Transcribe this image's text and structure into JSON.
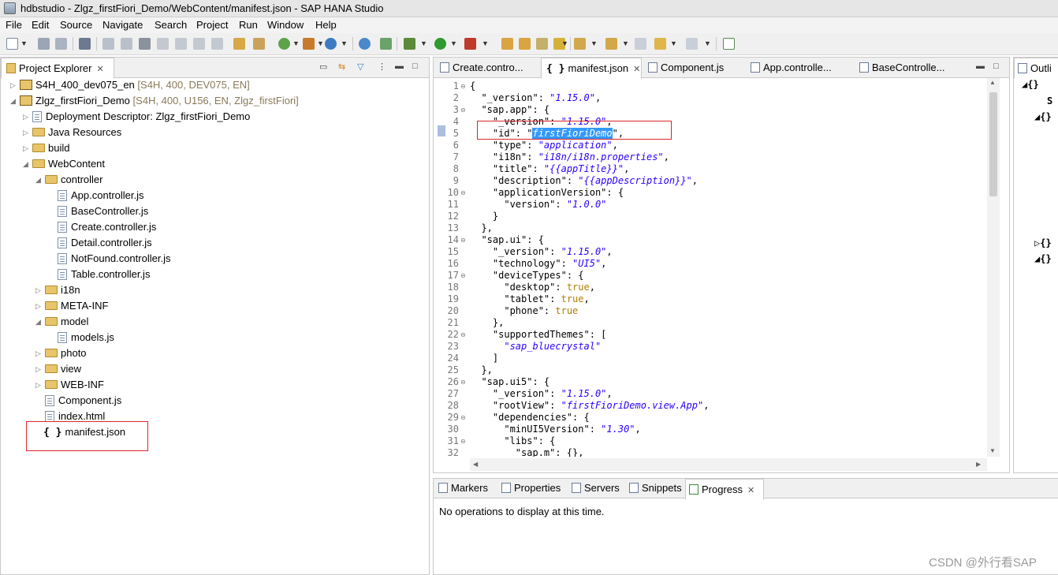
{
  "window": {
    "title": "hdbstudio - Zlgz_firstFiori_Demo/WebContent/manifest.json - SAP HANA Studio"
  },
  "menu": [
    "File",
    "Edit",
    "Source",
    "Navigate",
    "Search",
    "Project",
    "Run",
    "Window",
    "Help"
  ],
  "explorer": {
    "tab_label": "Project Explorer",
    "items": [
      {
        "label": "S4H_400_dev075_en",
        "suffix": "[S4H, 400, DEV075, EN]"
      },
      {
        "label": "Zlgz_firstFiori_Demo",
        "suffix": "[S4H, 400, U156, EN, Zlgz_firstFiori]"
      },
      {
        "label": "Deployment Descriptor: Zlgz_firstFiori_Demo"
      },
      {
        "label": "Java Resources"
      },
      {
        "label": "build"
      },
      {
        "label": "WebContent"
      },
      {
        "label": "controller"
      },
      {
        "label": "App.controller.js"
      },
      {
        "label": "BaseController.js"
      },
      {
        "label": "Create.controller.js"
      },
      {
        "label": "Detail.controller.js"
      },
      {
        "label": "NotFound.controller.js"
      },
      {
        "label": "Table.controller.js"
      },
      {
        "label": "i18n"
      },
      {
        "label": "META-INF"
      },
      {
        "label": "model"
      },
      {
        "label": "models.js"
      },
      {
        "label": "photo"
      },
      {
        "label": "view"
      },
      {
        "label": "WEB-INF"
      },
      {
        "label": "Component.js"
      },
      {
        "label": "index.html"
      },
      {
        "label": "manifest.json"
      }
    ]
  },
  "editor": {
    "tabs": [
      "Create.contro...",
      "manifest.json",
      "Component.js",
      "App.controlle...",
      "BaseControlle..."
    ],
    "lines": [
      [
        [
          "k",
          "{"
        ]
      ],
      [
        [
          "k",
          "  \"_version\": "
        ],
        [
          "s",
          "\"1.15.0\""
        ],
        [
          "k",
          ","
        ]
      ],
      [
        [
          "k",
          "  \"sap.app\": {"
        ]
      ],
      [
        [
          "k",
          "    \"_version\": "
        ],
        [
          "s",
          "\"1.15.0\""
        ],
        [
          "k",
          ","
        ]
      ],
      [
        [
          "k",
          "    \"id\": \""
        ],
        [
          "sel",
          "firstFioriDemo"
        ],
        [
          "k",
          "\","
        ]
      ],
      [
        [
          "k",
          "    \"type\": "
        ],
        [
          "s",
          "\"application\""
        ],
        [
          "k",
          ","
        ]
      ],
      [
        [
          "k",
          "    \"i18n\": "
        ],
        [
          "s",
          "\"i18n/i18n.properties\""
        ],
        [
          "k",
          ","
        ]
      ],
      [
        [
          "k",
          "    \"title\": "
        ],
        [
          "s",
          "\"{{appTitle}}\""
        ],
        [
          "k",
          ","
        ]
      ],
      [
        [
          "k",
          "    \"description\": "
        ],
        [
          "s",
          "\"{{appDescription}}\""
        ],
        [
          "k",
          ","
        ]
      ],
      [
        [
          "k",
          "    \"applicationVersion\": {"
        ]
      ],
      [
        [
          "k",
          "      \"version\": "
        ],
        [
          "s",
          "\"1.0.0\""
        ]
      ],
      [
        [
          "k",
          "    }"
        ]
      ],
      [
        [
          "k",
          "  },"
        ]
      ],
      [
        [
          "k",
          "  \"sap.ui\": {"
        ]
      ],
      [
        [
          "k",
          "    \"_version\": "
        ],
        [
          "s",
          "\"1.15.0\""
        ],
        [
          "k",
          ","
        ]
      ],
      [
        [
          "k",
          "    \"technology\": "
        ],
        [
          "s",
          "\"UI5\""
        ],
        [
          "k",
          ","
        ]
      ],
      [
        [
          "k",
          "    \"deviceTypes\": {"
        ]
      ],
      [
        [
          "k",
          "      \"desktop\": "
        ],
        [
          "t",
          "true"
        ],
        [
          "k",
          ","
        ]
      ],
      [
        [
          "k",
          "      \"tablet\": "
        ],
        [
          "t",
          "true"
        ],
        [
          "k",
          ","
        ]
      ],
      [
        [
          "k",
          "      \"phone\": "
        ],
        [
          "t",
          "true"
        ]
      ],
      [
        [
          "k",
          "    },"
        ]
      ],
      [
        [
          "k",
          "    \"supportedThemes\": ["
        ]
      ],
      [
        [
          "s",
          "      \"sap_bluecrystal\""
        ]
      ],
      [
        [
          "k",
          "    ]"
        ]
      ],
      [
        [
          "k",
          "  },"
        ]
      ],
      [
        [
          "k",
          "  \"sap.ui5\": {"
        ]
      ],
      [
        [
          "k",
          "    \"_version\": "
        ],
        [
          "s",
          "\"1.15.0\""
        ],
        [
          "k",
          ","
        ]
      ],
      [
        [
          "k",
          "    \"rootView\": "
        ],
        [
          "s",
          "\"firstFioriDemo.view.App\""
        ],
        [
          "k",
          ","
        ]
      ],
      [
        [
          "k",
          "    \"dependencies\": {"
        ]
      ],
      [
        [
          "k",
          "      \"minUI5Version\": "
        ],
        [
          "s",
          "\"1.30\""
        ],
        [
          "k",
          ","
        ]
      ],
      [
        [
          "k",
          "      \"libs\": {"
        ]
      ],
      [
        [
          "k",
          "        \"sap.m\": {},"
        ]
      ]
    ]
  },
  "bottom": {
    "tabs": [
      "Markers",
      "Properties",
      "Servers",
      "Snippets",
      "Progress"
    ],
    "message": "No operations to display at this time."
  },
  "outline": {
    "tab_label": "Outli"
  },
  "watermark": "CSDN @外行看SAP"
}
